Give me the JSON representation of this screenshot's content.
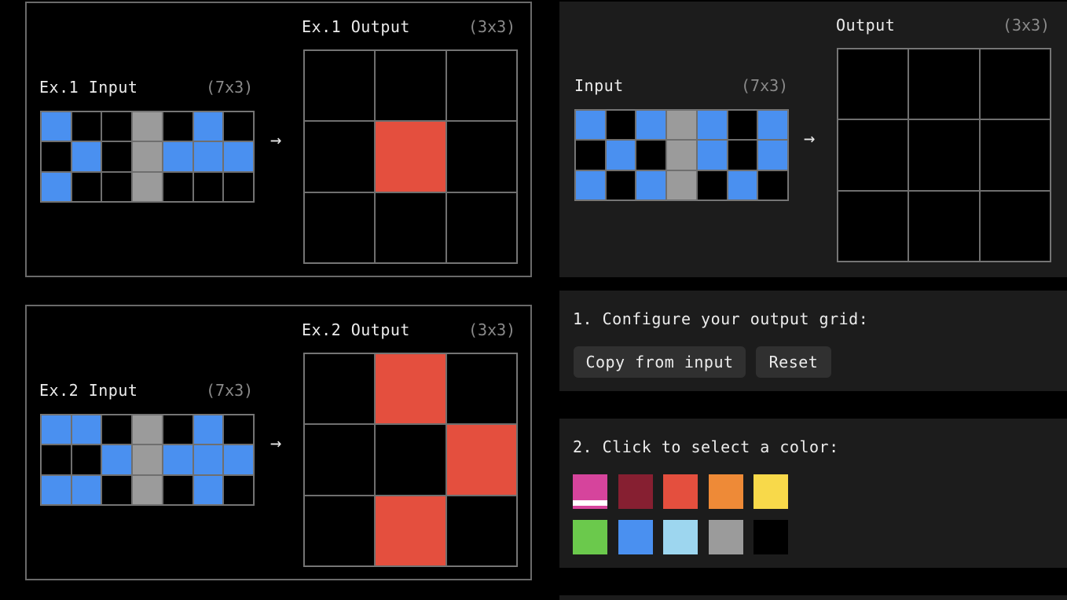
{
  "palette": {
    "0": "#000000",
    "1": "#4a90f0",
    "2": "#e44f3e",
    "5": "#9b9b9b"
  },
  "examples": [
    {
      "input_label": "Ex.1 Input",
      "input_dims": "(7x3)",
      "output_label": "Ex.1 Output",
      "output_dims": "(3x3)",
      "input": [
        [
          1,
          0,
          0,
          5,
          0,
          1,
          0
        ],
        [
          0,
          1,
          0,
          5,
          1,
          1,
          1
        ],
        [
          1,
          0,
          0,
          5,
          0,
          0,
          0
        ]
      ],
      "output": [
        [
          0,
          0,
          0
        ],
        [
          0,
          2,
          0
        ],
        [
          0,
          0,
          0
        ]
      ]
    },
    {
      "input_label": "Ex.2 Input",
      "input_dims": "(7x3)",
      "output_label": "Ex.2 Output",
      "output_dims": "(3x3)",
      "input": [
        [
          1,
          1,
          0,
          5,
          0,
          1,
          0
        ],
        [
          0,
          0,
          1,
          5,
          1,
          1,
          1
        ],
        [
          1,
          1,
          0,
          5,
          0,
          1,
          0
        ]
      ],
      "output": [
        [
          0,
          2,
          0
        ],
        [
          0,
          0,
          2
        ],
        [
          0,
          2,
          0
        ]
      ]
    }
  ],
  "test": {
    "input_label": "Input",
    "input_dims": "(7x3)",
    "output_label": "Output",
    "output_dims": "(3x3)",
    "input": [
      [
        1,
        0,
        1,
        5,
        1,
        0,
        1
      ],
      [
        0,
        1,
        0,
        5,
        1,
        0,
        1
      ],
      [
        1,
        0,
        1,
        5,
        0,
        1,
        0
      ]
    ],
    "output": [
      [
        0,
        0,
        0
      ],
      [
        0,
        0,
        0
      ],
      [
        0,
        0,
        0
      ]
    ]
  },
  "arrow": "→",
  "configure": {
    "heading": "1. Configure your output grid:",
    "copy_button": "Copy from input",
    "reset_button": "Reset"
  },
  "color_select": {
    "heading": "2. Click to select a color:",
    "selected_index": 0,
    "colors": [
      {
        "name": "magenta",
        "hex": "#d6449c"
      },
      {
        "name": "maroon",
        "hex": "#861f31"
      },
      {
        "name": "red",
        "hex": "#e44f3e"
      },
      {
        "name": "orange",
        "hex": "#ee8a37"
      },
      {
        "name": "yellow",
        "hex": "#f8d94a"
      },
      {
        "name": "green",
        "hex": "#6bc94c"
      },
      {
        "name": "blue",
        "hex": "#4a90f0"
      },
      {
        "name": "light-blue",
        "hex": "#9dd6ef"
      },
      {
        "name": "gray",
        "hex": "#9b9b9b"
      },
      {
        "name": "black",
        "hex": "#000000"
      }
    ]
  }
}
